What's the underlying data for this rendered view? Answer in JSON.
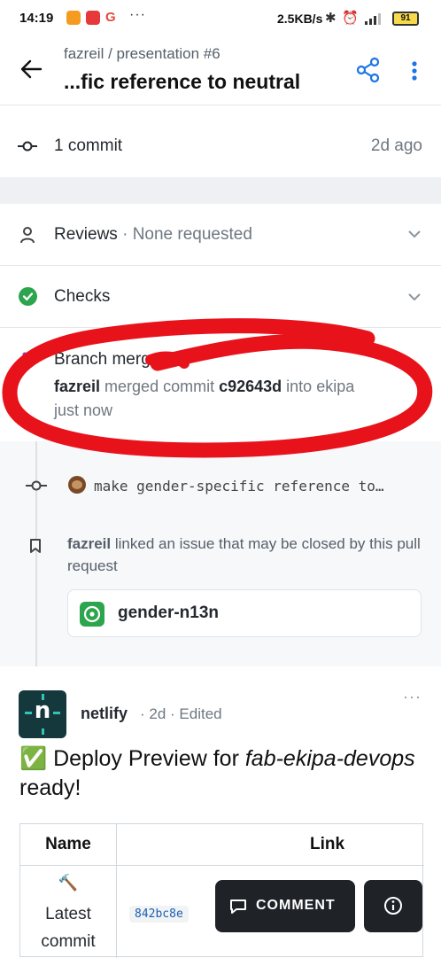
{
  "status_bar": {
    "time": "14:19",
    "network_speed": "2.5KB/s",
    "battery": "91",
    "app_icons": [
      "orange-app-icon",
      "red-app-icon",
      "google-icon"
    ],
    "google_glyph": "G",
    "more": "···"
  },
  "header": {
    "subtitle": "fazreil / presentation #6",
    "title": "...fic reference to neutral"
  },
  "commits": {
    "label": "1 commit",
    "time": "2d ago"
  },
  "reviews": {
    "label": "Reviews",
    "separator": "·",
    "status": "None requested"
  },
  "checks": {
    "label": "Checks"
  },
  "merge": {
    "title": "Branch merged",
    "user": "fazreil",
    "verb": "merged commit",
    "commit": "c92643d",
    "into": "into ekipa",
    "time": "just now"
  },
  "timeline": {
    "commit_message": "make gender-specific reference to…",
    "linked_user": "fazreil",
    "linked_text": "linked an issue that may be closed by this pull request",
    "issue_name": "gender-n13n"
  },
  "comment": {
    "author": "netlify",
    "meta": "· 2d · Edited",
    "logo_text": "n",
    "title_emoji": "✅",
    "title_pre": "Deploy Preview for ",
    "title_em": "fab-ekipa-devops",
    "title_post": " ready!",
    "more": "···"
  },
  "deploy_table": {
    "headers": [
      "Name",
      "Link"
    ],
    "rows": [
      {
        "icon": "🔨",
        "name": "Latest commit",
        "link": "842bc8e"
      }
    ]
  },
  "actions": {
    "comment_label": "COMMENT"
  },
  "colors": {
    "check_green": "#2da44e",
    "annotation_red": "#e8121b",
    "merged_purple": "#8250df",
    "netlify_bg": "#14383b"
  }
}
